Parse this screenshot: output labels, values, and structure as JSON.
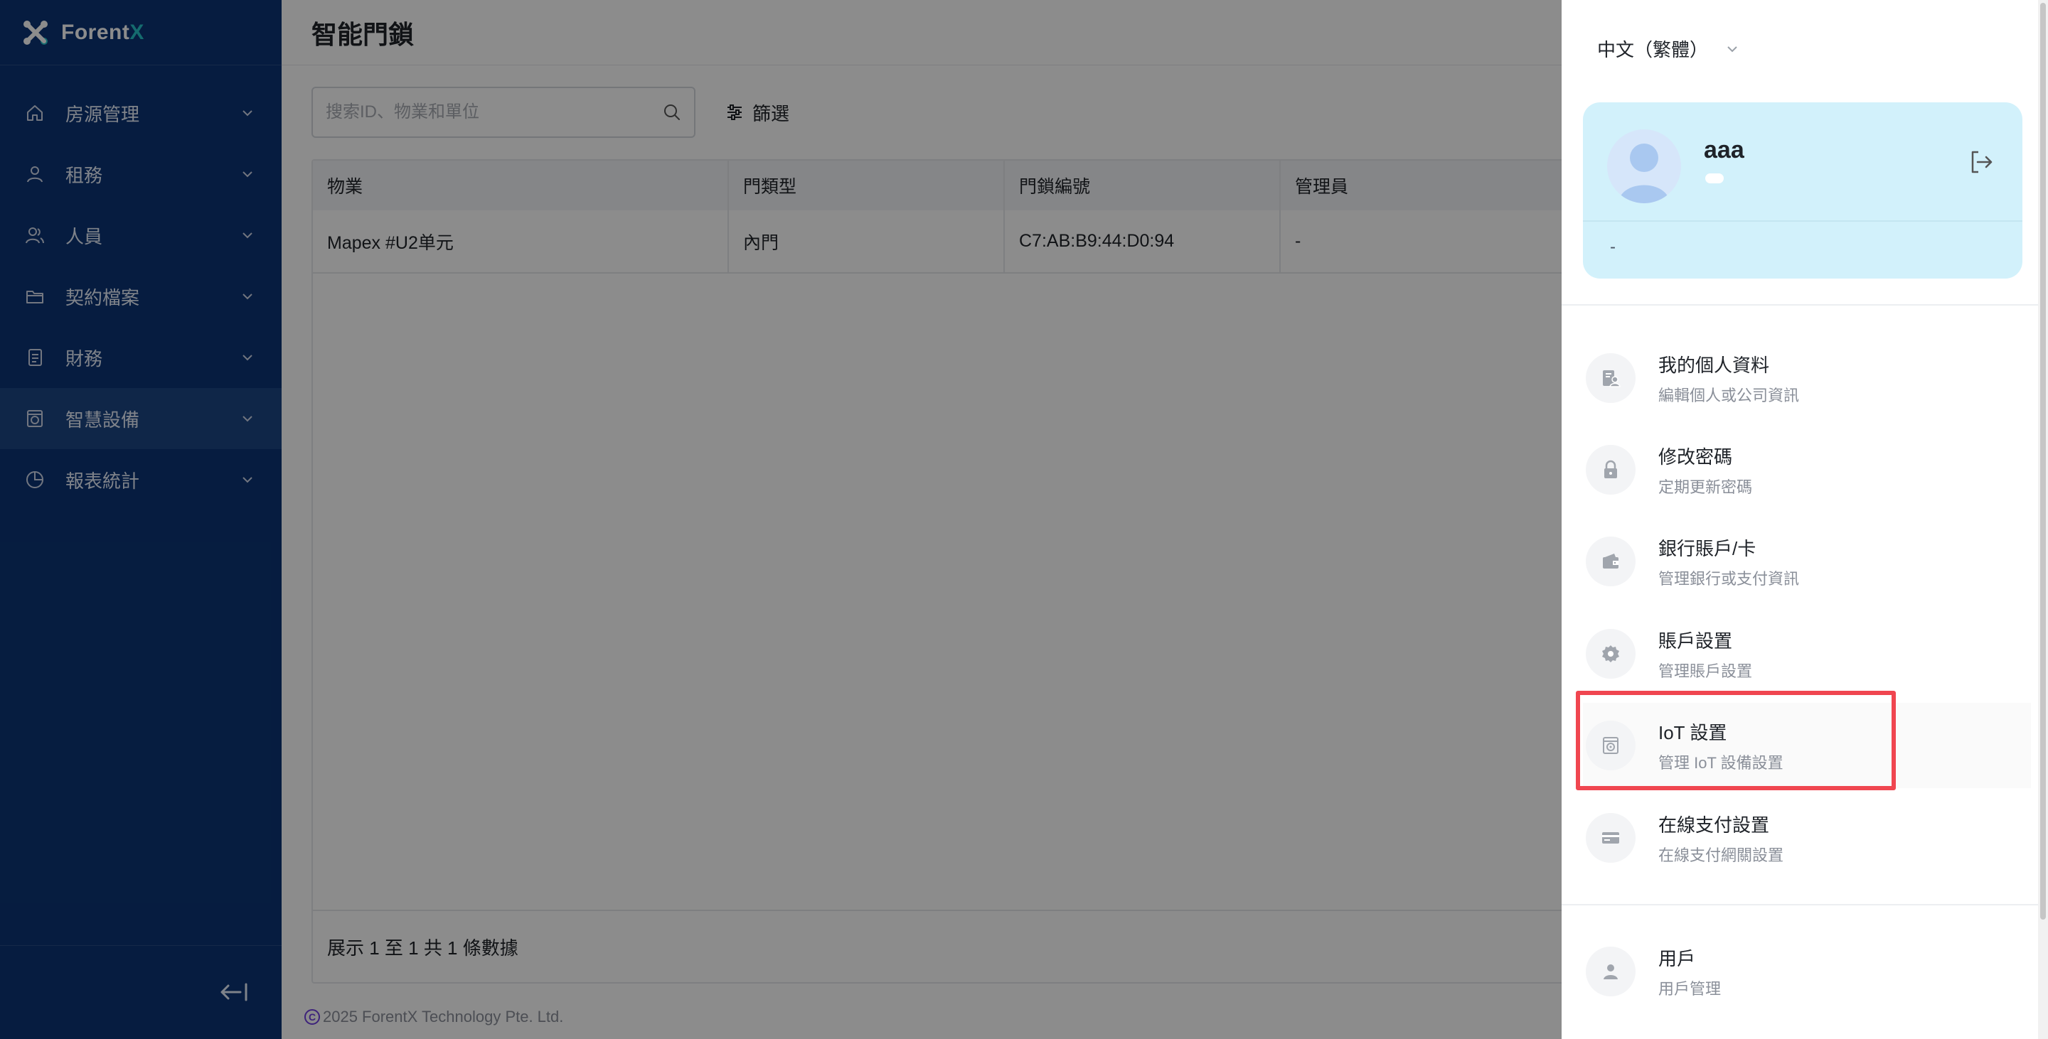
{
  "brand": {
    "name_prefix": "Forent",
    "name_suffix": "X"
  },
  "sidebar": {
    "items": [
      {
        "label": "房源管理",
        "icon": "home-icon"
      },
      {
        "label": "租務",
        "icon": "user-icon"
      },
      {
        "label": "人員",
        "icon": "users-icon"
      },
      {
        "label": "契約檔案",
        "icon": "folder-icon"
      },
      {
        "label": "財務",
        "icon": "document-icon"
      },
      {
        "label": "智慧設備",
        "icon": "device-icon",
        "active": true
      },
      {
        "label": "報表統計",
        "icon": "pie-chart-icon"
      }
    ]
  },
  "page": {
    "title": "智能門鎖",
    "search_placeholder": "搜索ID、物業和單位",
    "filter_label": "篩選"
  },
  "table": {
    "columns": [
      "物業",
      "門類型",
      "門鎖編號",
      "管理員"
    ],
    "rows": [
      [
        "Mapex #U2单元",
        "內門",
        "C7:AB:B9:44:D0:94",
        "-"
      ]
    ],
    "footer": "展示 1 至 1 共 1 條數據"
  },
  "footer": {
    "copyright": "2025 ForentX Technology Pte. Ltd."
  },
  "drawer": {
    "language": "中文（繁體）",
    "user": {
      "name": "aaa",
      "detail": "-"
    },
    "menu": [
      {
        "title": "我的個人資料",
        "desc": "編輯個人或公司資訊",
        "icon": "profile-icon"
      },
      {
        "title": "修改密碼",
        "desc": "定期更新密碼",
        "icon": "lock-icon"
      },
      {
        "title": "銀行賬戶/卡",
        "desc": "管理銀行或支付資訊",
        "icon": "wallet-icon"
      },
      {
        "title": "賬戶設置",
        "desc": "管理賬戶設置",
        "icon": "gear-icon"
      },
      {
        "title": "IoT 設置",
        "desc": "管理 IoT 設備設置",
        "icon": "iot-device-icon"
      },
      {
        "title": "在線支付設置",
        "desc": "在線支付網關設置",
        "icon": "credit-card-icon"
      },
      {
        "title": "用戶",
        "desc": "用戶管理",
        "icon": "person-icon"
      }
    ]
  },
  "colors": {
    "sidebar": "#0b3475",
    "sidebar_active": "#1d4584",
    "accent": "#27c3c9",
    "profile_card": "#d2f1fb",
    "highlight_border": "#f04650"
  }
}
